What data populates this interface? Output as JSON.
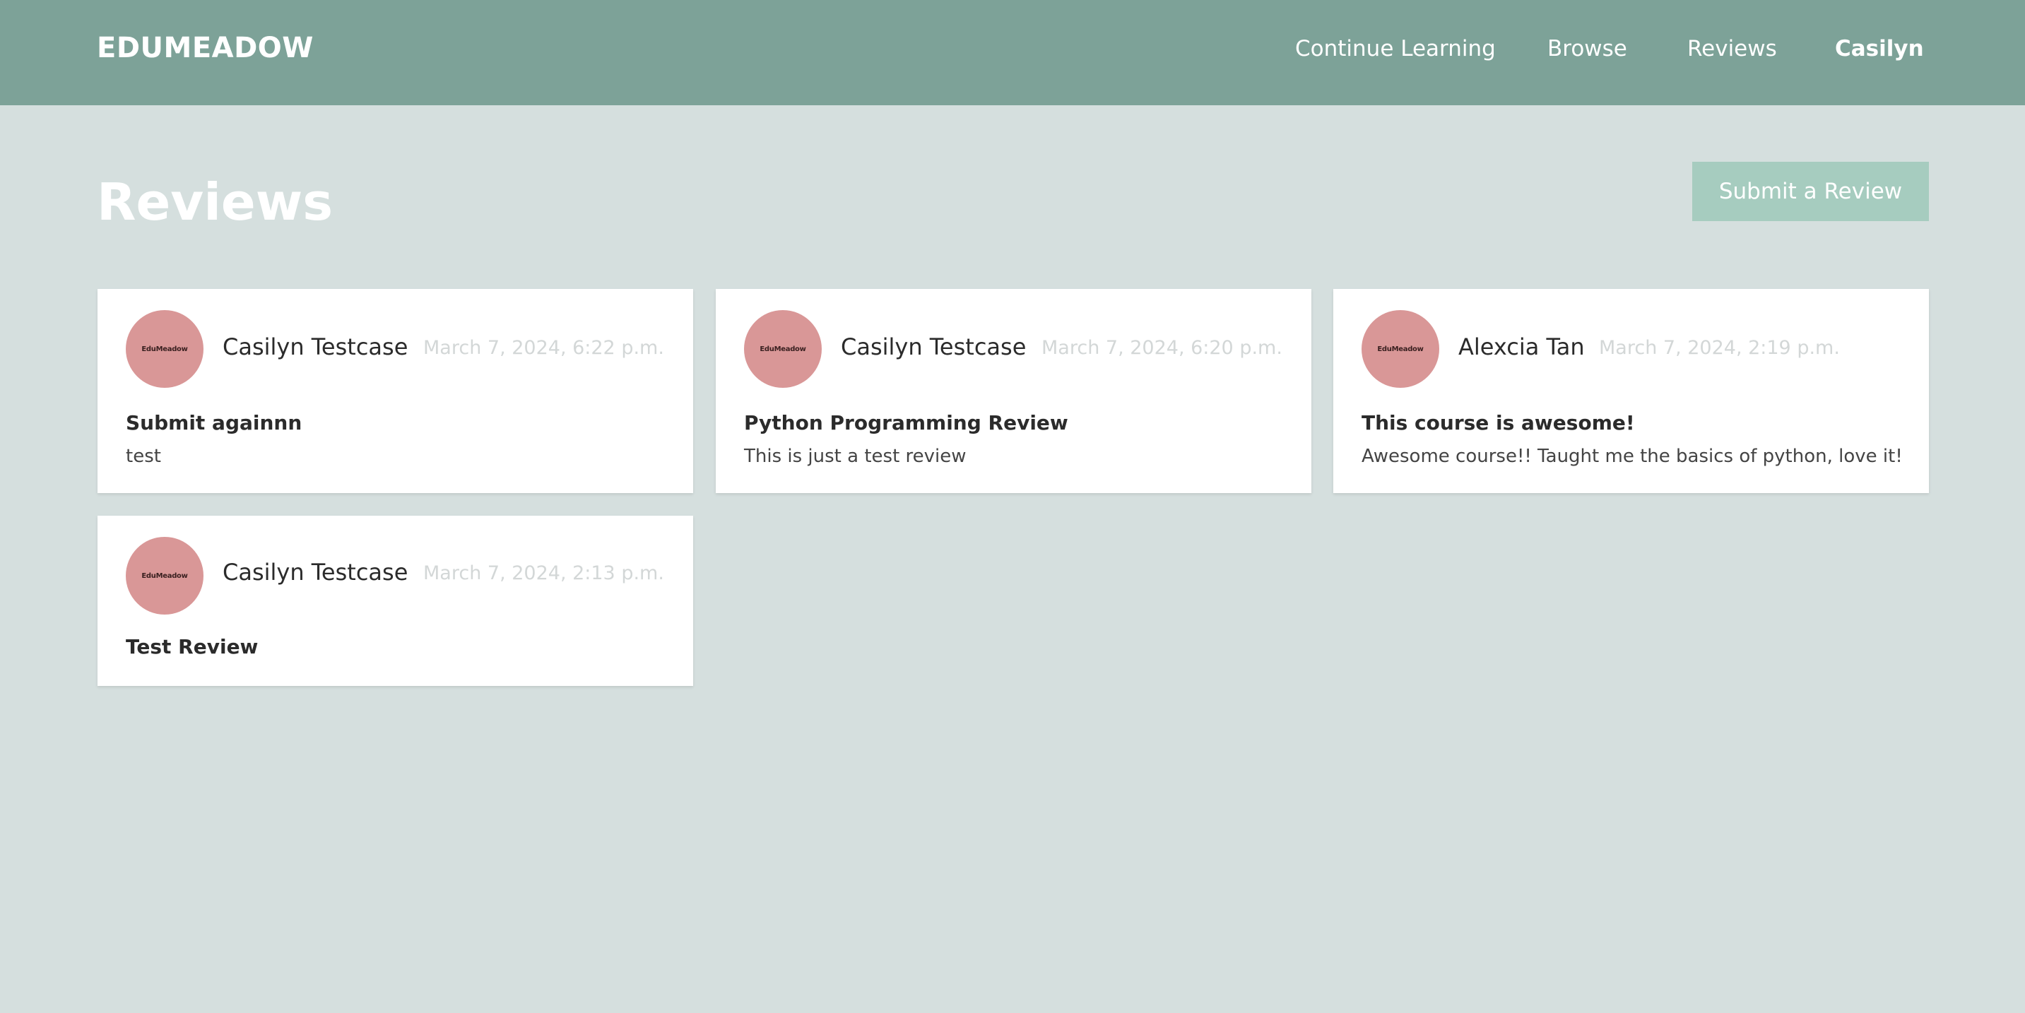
{
  "navbar": {
    "brand": "EDUMEADOW",
    "links": [
      {
        "label": "Continue Learning"
      },
      {
        "label": "Browse"
      },
      {
        "label": "Reviews"
      },
      {
        "label": "Casilyn"
      }
    ]
  },
  "page": {
    "title": "Reviews",
    "submit_label": "Submit a Review"
  },
  "avatar_text": "EduMeadow",
  "reviews": [
    {
      "author": "Casilyn Testcase",
      "date": "March 7, 2024, 6:22 p.m.",
      "title": "Submit againnn",
      "body": "test"
    },
    {
      "author": "Casilyn Testcase",
      "date": "March 7, 2024, 6:20 p.m.",
      "title": "Python Programming Review",
      "body": "This is just a test review"
    },
    {
      "author": "Alexcia Tan",
      "date": "March 7, 2024, 2:19 p.m.",
      "title": "This course is awesome!",
      "body": "Awesome course!! Taught me the basics of python, love it!"
    },
    {
      "author": "Casilyn Testcase",
      "date": "March 7, 2024, 2:13 p.m.",
      "title": "Test Review",
      "body": ""
    }
  ],
  "colors": {
    "navbar": "#7da298",
    "background": "#d5dfde",
    "button": "#a6ccbf",
    "avatar": "#d99797"
  }
}
